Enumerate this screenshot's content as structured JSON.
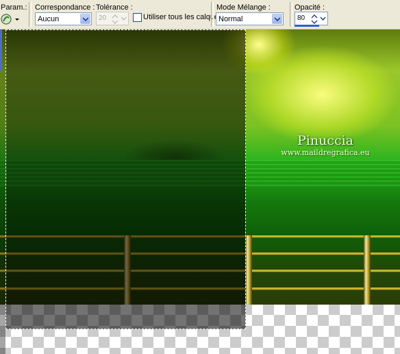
{
  "toolbar": {
    "preset_label": "Param.:",
    "match_mode_label": "Correspondance :",
    "match_mode_value": "Aucun",
    "tolerance_label": "Tolérance :",
    "tolerance_value": "20",
    "use_all_layers_label": "Utiliser tous les calques",
    "use_all_layers_checked": false,
    "blend_mode_label": "Mode Mélange :",
    "blend_mode_value": "Normal",
    "opacity_label": "Opacité :",
    "opacity_value": "80"
  },
  "canvas": {
    "watermark_title": "Pinuccia",
    "watermark_url": "www.maildregrafica.eu"
  },
  "colors": {
    "toolbar_bg": "#ece9d8",
    "combo_border": "#7f9db9",
    "image_green": "#1e9a14",
    "rail_gold": "#c6b32a"
  },
  "icons": [
    "preset-icon",
    "dropdown-arrow-icon",
    "spin-up-icon",
    "spin-down-icon",
    "checkbox-icon"
  ]
}
